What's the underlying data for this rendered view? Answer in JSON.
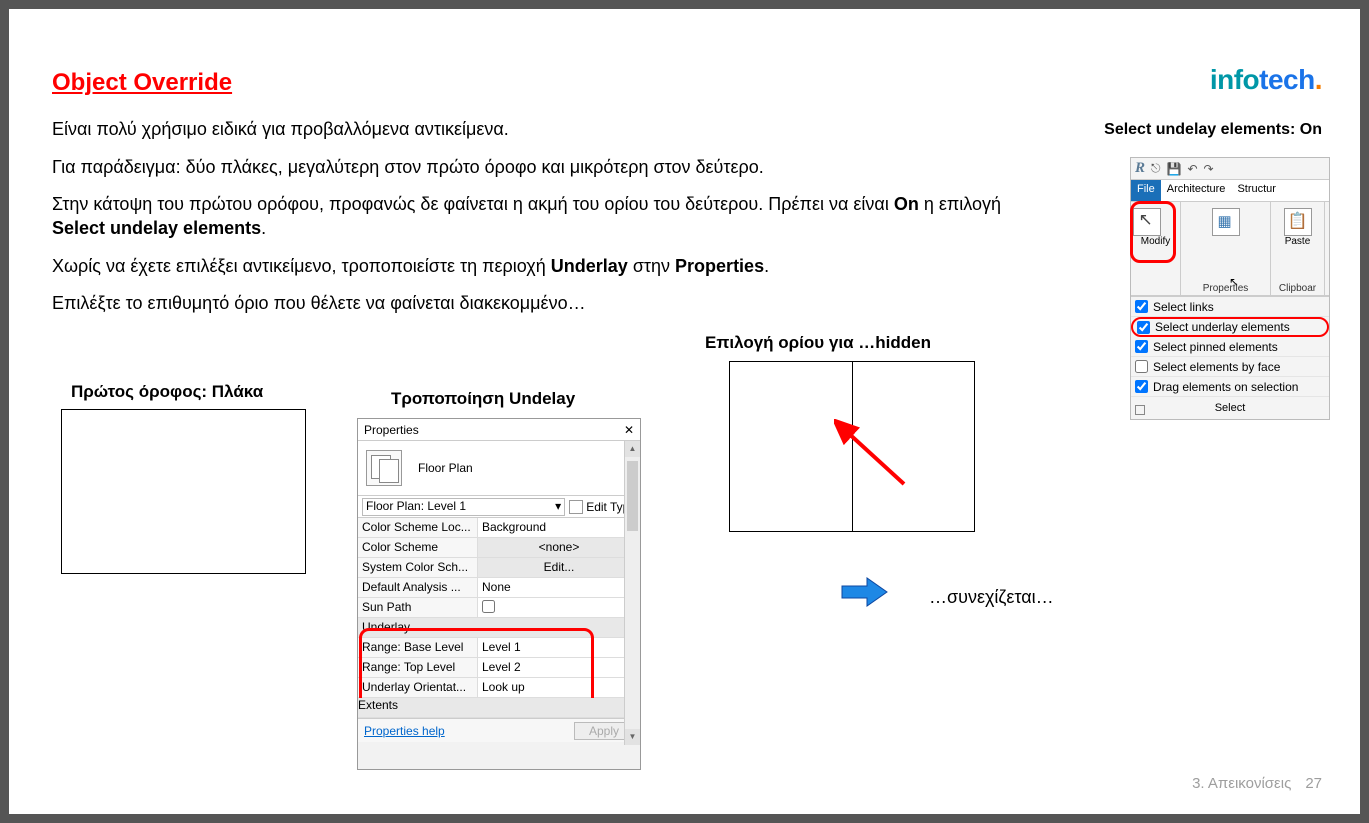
{
  "title": "Object Override",
  "paragraphs": {
    "p1": "Είναι πολύ χρήσιμο ειδικά για προβαλλόμενα αντικείμενα.",
    "p2": "Για παράδειγμα: δύο πλάκες, μεγαλύτερη στον πρώτο όροφο και μικρότερη στον δεύτερο.",
    "p3_a": "Στην κάτοψη του πρώτου ορόφου, προφανώς δε φαίνεται η ακμή του ορίου του δεύτερου. Πρέπει να είναι ",
    "p3_b": "On",
    "p3_c": " η επιλογή ",
    "p3_d": "Select undelay elements",
    "p3_e": ".",
    "p4_a": "Χωρίς να έχετε επιλέξει αντικείμενο, τροποποιείστε τη περιοχή ",
    "p4_b": "Underlay",
    "p4_c": " στην ",
    "p4_d": "Properties",
    "p4_e": ".",
    "p5": "Επιλέξτε το επιθυμητό όριο που θέλετε να φαίνεται διακεκομμένο…"
  },
  "logo": {
    "left": "info",
    "right": "tech",
    "dot": "."
  },
  "underlay_on": "Select undelay elements: On",
  "captions": {
    "slab": "Πρώτος όροφος: Πλάκα",
    "undelay": "Τροποποίηση Undelay",
    "hidden": "Επιλογή ορίου για …hidden"
  },
  "continue_text": "…συνεχίζεται…",
  "properties": {
    "title": "Properties",
    "floor_plan": "Floor Plan",
    "instance": "Floor Plan: Level 1",
    "edit_type": "Edit Type",
    "rows": {
      "r1l": "Color Scheme Loc...",
      "r1v": "Background",
      "r2l": "Color Scheme",
      "r2v": "<none>",
      "r3l": "System Color Sch...",
      "r3v": "Edit...",
      "r4l": "Default Analysis ...",
      "r4v": "None",
      "r5l": "Sun Path",
      "r5v": ""
    },
    "underlay_sect": "Underlay",
    "urows": {
      "u1l": "Range: Base Level",
      "u1v": "Level 1",
      "u2l": "Range: Top Level",
      "u2v": "Level 2",
      "u3l": "Underlay Orientat...",
      "u3v": "Look up"
    },
    "extents": "Extents",
    "help": "Properties help",
    "apply": "Apply"
  },
  "ribbon": {
    "tabs": {
      "file": "File",
      "arch": "Architecture",
      "struct": "Structur"
    },
    "modify": "Modify",
    "properties": "Properties",
    "paste": "Paste",
    "clipboard": "Clipboar",
    "options": {
      "links": "Select links",
      "underlay": "Select underlay elements",
      "pinned": "Select pinned elements",
      "face": "Select elements by face",
      "drag": "Drag elements on selection"
    },
    "select_label": "Select"
  },
  "footer": {
    "section": "3. Απεικονίσεις",
    "page": "27"
  }
}
